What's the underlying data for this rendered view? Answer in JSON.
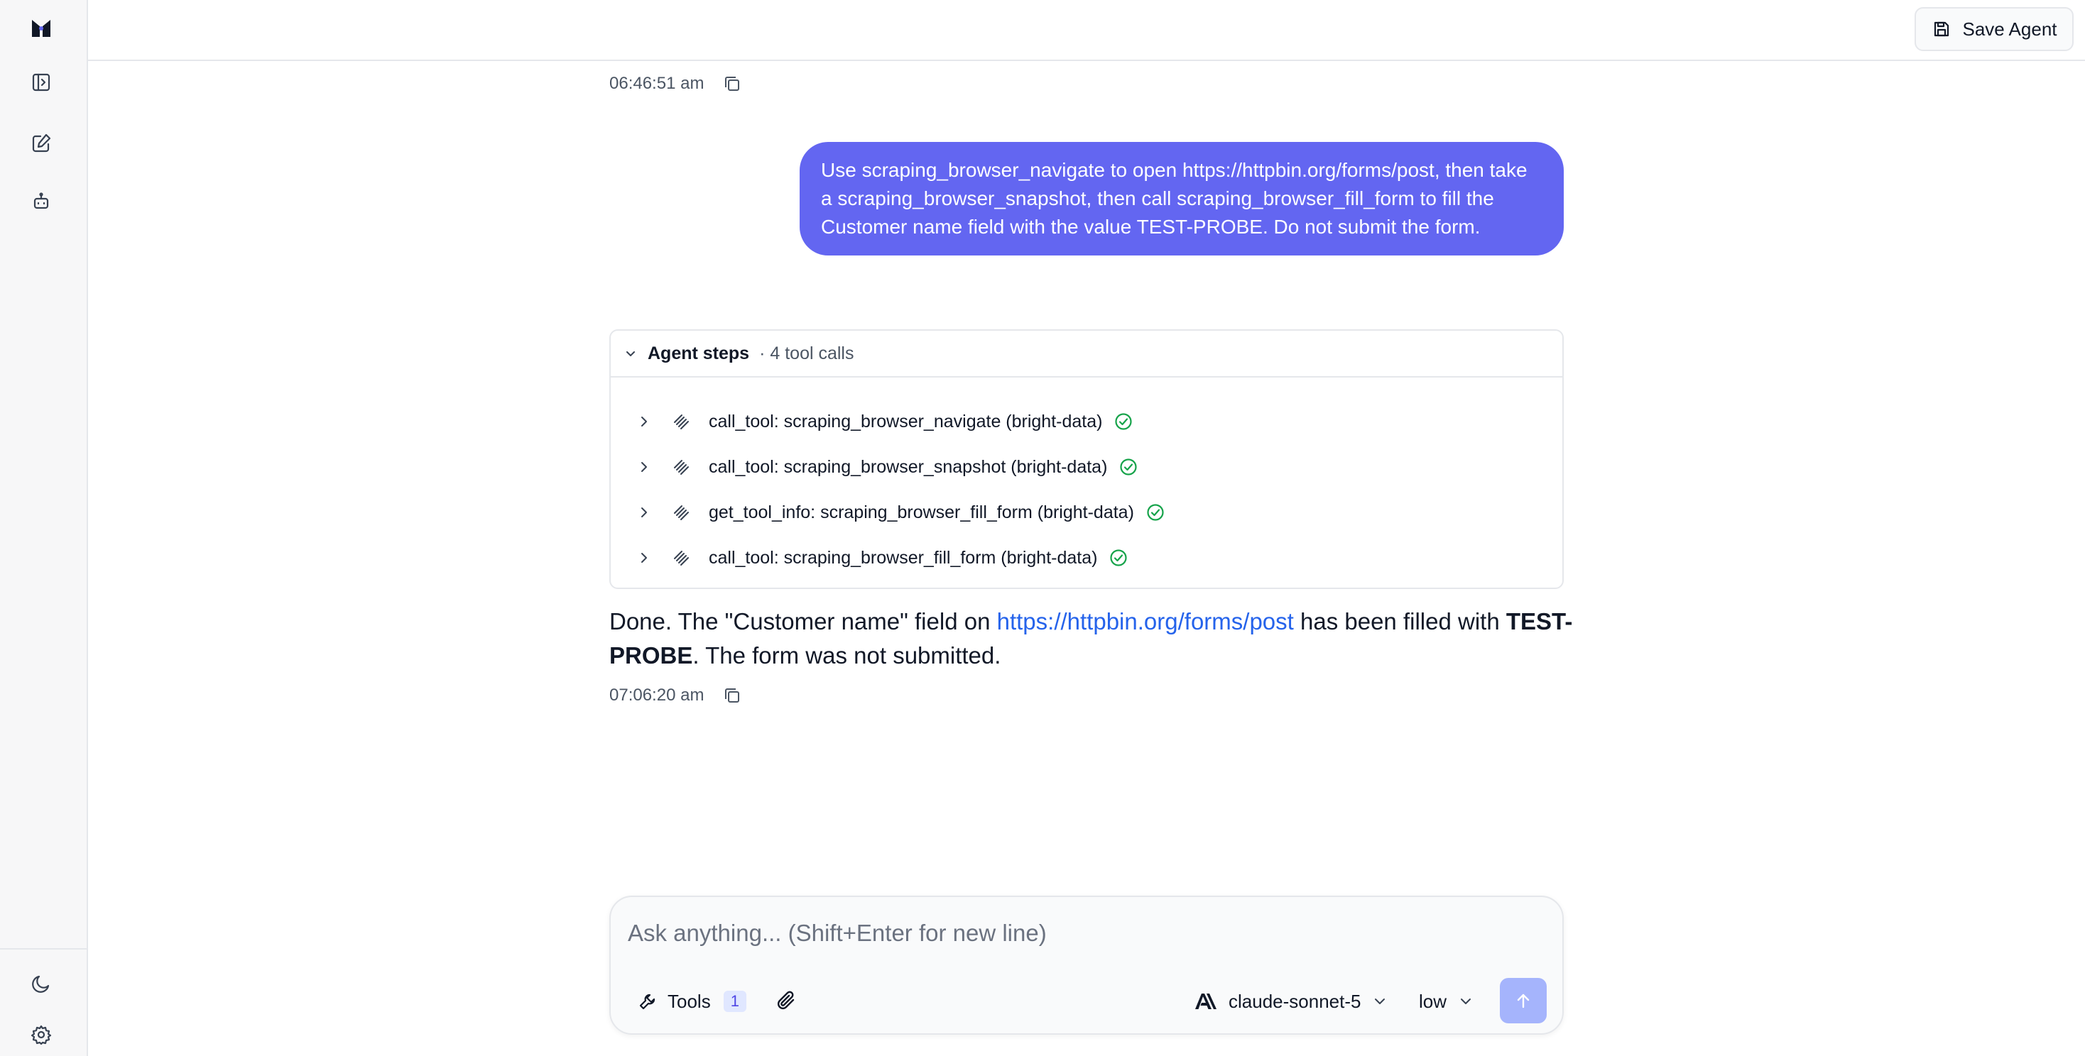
{
  "sidebar": {
    "icons": [
      "app-logo-icon",
      "toggle-sidebar-icon",
      "new-chat-icon",
      "agents-bot-icon",
      "moon-icon",
      "gear-icon"
    ]
  },
  "header": {
    "save_label": "Save Agent"
  },
  "conversation": {
    "first_timestamp": "06:46:51 am",
    "user_message": "Use scraping_browser_navigate to open https://httpbin.org/forms/post, then take a scraping_browser_snapshot, then call scraping_browser_fill_form to fill the Customer name field with the value TEST-PROBE. Do not submit the form.",
    "agent_steps": {
      "title": "Agent steps",
      "count": "· 4 tool calls",
      "items": [
        {
          "label": "call_tool: scraping_browser_navigate (bright-data)"
        },
        {
          "label": "call_tool: scraping_browser_snapshot (bright-data)"
        },
        {
          "label": "get_tool_info: scraping_browser_fill_form (bright-data)"
        },
        {
          "label": "call_tool: scraping_browser_fill_form (bright-data)"
        }
      ]
    },
    "reply": {
      "part1": "Done. The \"Customer name\" field on ",
      "link": "https://httpbin.org/forms/post",
      "part2": " has been filled with ",
      "bold": "TEST-PROBE",
      "part3": ". The form was not submitted."
    },
    "second_timestamp": "07:06:20 am"
  },
  "composer": {
    "placeholder": "Ask anything... (Shift+Enter for new line)",
    "tools_label": "Tools",
    "tools_count": "1",
    "model": "claude-sonnet-5",
    "effort": "low"
  },
  "colors": {
    "accent": "#6366f1",
    "link": "#2563eb",
    "success": "#16a34a",
    "send_disabled": "#a5b4fc"
  }
}
